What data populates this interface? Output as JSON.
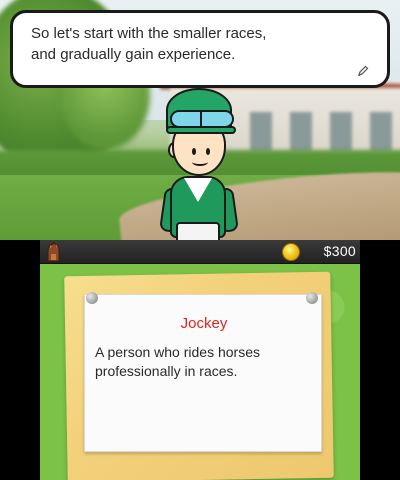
{
  "top_screen": {
    "speech": "So let's start with the smaller races,\nand gradually gain experience.",
    "pencil_icon": "pencil-icon"
  },
  "status_bar": {
    "horse_icon": "horse-head-icon",
    "coin_icon": "coin-icon",
    "money": "$300"
  },
  "glossary_note": {
    "title": "Jockey",
    "definition": "A person who rides horses professionally in races."
  },
  "colors": {
    "title_red": "#e52222",
    "grass_green": "#7bc247",
    "jockey_green": "#1f9a5c"
  }
}
